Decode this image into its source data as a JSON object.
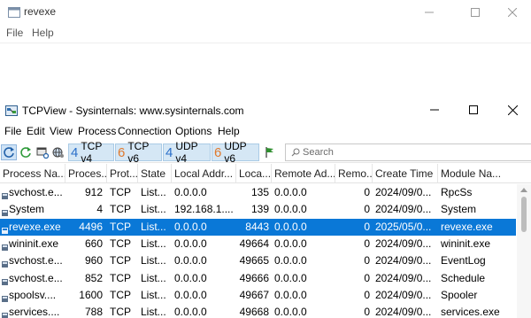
{
  "background_window": {
    "title": "revexe",
    "menu": [
      "File",
      "Help"
    ]
  },
  "tcpview": {
    "title": "TCPView - Sysinternals: www.sysinternals.com",
    "menu": [
      "File",
      "Edit",
      "View",
      "Process",
      "Connection",
      "Options",
      "Help"
    ],
    "toolbar": {
      "filters": [
        {
          "num": "4",
          "label": "TCP v4",
          "color": "#2a6fc9"
        },
        {
          "num": "6",
          "label": "TCP v6",
          "color": "#e07a2e"
        },
        {
          "num": "4",
          "label": "UDP v4",
          "color": "#2a6fc9"
        },
        {
          "num": "6",
          "label": "UDP v6",
          "color": "#e07a2e"
        }
      ],
      "search_placeholder": "Search"
    },
    "columns": [
      "Process Na...",
      "Proces...",
      "Prot...",
      "State",
      "Local Addr...",
      "Loca...",
      "Remote Ad...",
      "Remo...",
      "Create Time",
      "Module Na..."
    ],
    "rows": [
      {
        "process": "svchost.e...",
        "pid": "912",
        "protocol": "TCP",
        "state": "List...",
        "local_address": "0.0.0.0",
        "local_port": "135",
        "remote_address": "0.0.0.0",
        "remote_port": "0",
        "create_time": "2024/09/0...",
        "module": "RpcSs",
        "selected": false
      },
      {
        "process": "System",
        "pid": "4",
        "protocol": "TCP",
        "state": "List...",
        "local_address": "192.168.1....",
        "local_port": "139",
        "remote_address": "0.0.0.0",
        "remote_port": "0",
        "create_time": "2024/09/0...",
        "module": "System",
        "selected": false
      },
      {
        "process": "revexe.exe",
        "pid": "4496",
        "protocol": "TCP",
        "state": "List...",
        "local_address": "0.0.0.0",
        "local_port": "8443",
        "remote_address": "0.0.0.0",
        "remote_port": "0",
        "create_time": "2025/05/0...",
        "module": "revexe.exe",
        "selected": true
      },
      {
        "process": "wininit.exe",
        "pid": "660",
        "protocol": "TCP",
        "state": "List...",
        "local_address": "0.0.0.0",
        "local_port": "49664",
        "remote_address": "0.0.0.0",
        "remote_port": "0",
        "create_time": "2024/09/0...",
        "module": "wininit.exe",
        "selected": false
      },
      {
        "process": "svchost.e...",
        "pid": "960",
        "protocol": "TCP",
        "state": "List...",
        "local_address": "0.0.0.0",
        "local_port": "49665",
        "remote_address": "0.0.0.0",
        "remote_port": "0",
        "create_time": "2024/09/0...",
        "module": "EventLog",
        "selected": false
      },
      {
        "process": "svchost.e...",
        "pid": "852",
        "protocol": "TCP",
        "state": "List...",
        "local_address": "0.0.0.0",
        "local_port": "49666",
        "remote_address": "0.0.0.0",
        "remote_port": "0",
        "create_time": "2024/09/0...",
        "module": "Schedule",
        "selected": false
      },
      {
        "process": "spoolsv....",
        "pid": "1600",
        "protocol": "TCP",
        "state": "List...",
        "local_address": "0.0.0.0",
        "local_port": "49667",
        "remote_address": "0.0.0.0",
        "remote_port": "0",
        "create_time": "2024/09/0...",
        "module": "Spooler",
        "selected": false
      },
      {
        "process": "services....",
        "pid": "788",
        "protocol": "TCP",
        "state": "List...",
        "local_address": "0.0.0.0",
        "local_port": "49668",
        "remote_address": "0.0.0.0",
        "remote_port": "0",
        "create_time": "2024/09/0...",
        "module": "services.exe",
        "selected": false
      }
    ]
  }
}
